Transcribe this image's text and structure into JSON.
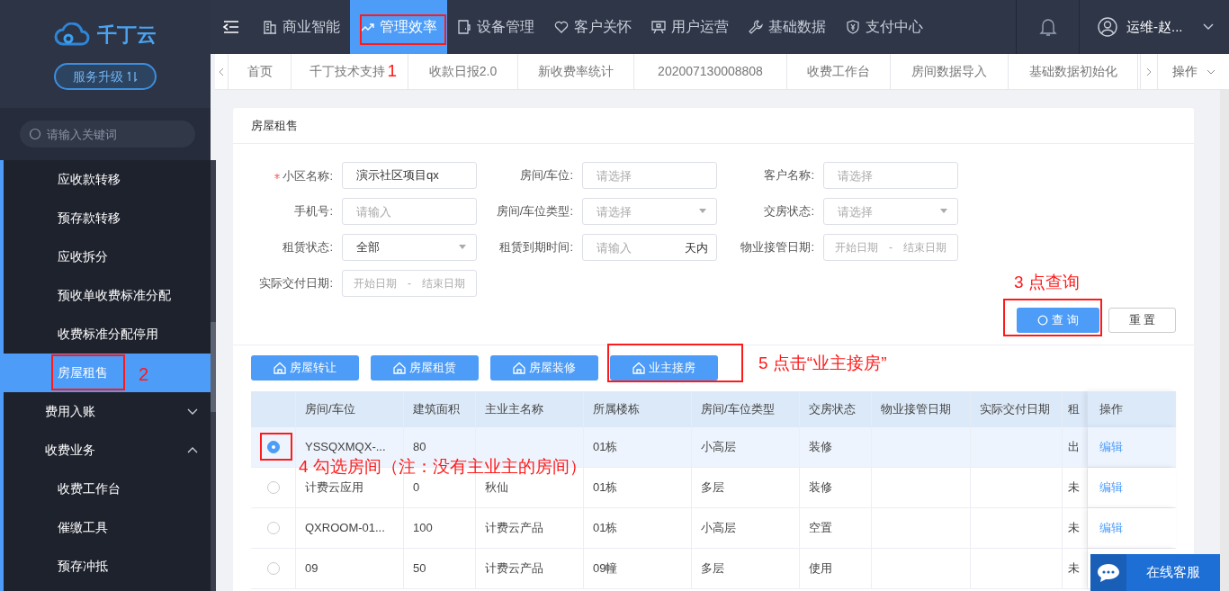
{
  "logo": {
    "text": "千丁云"
  },
  "upgrade_button": "服务升级",
  "top_nav": [
    {
      "label": "商业智能",
      "selected": false,
      "annotated": false
    },
    {
      "label": "管理效率",
      "selected": true,
      "annotated": true
    },
    {
      "label": "设备管理",
      "selected": false,
      "annotated": false
    },
    {
      "label": "客户关怀",
      "selected": false,
      "annotated": false
    },
    {
      "label": "用户运营",
      "selected": false,
      "annotated": false
    },
    {
      "label": "基础数据",
      "selected": false,
      "annotated": false
    },
    {
      "label": "支付中心",
      "selected": false,
      "annotated": false
    }
  ],
  "user": {
    "name": "运维-赵..."
  },
  "tabs": [
    {
      "label": "首页"
    },
    {
      "label": "千丁技术支持",
      "annotation": "1"
    },
    {
      "label": "收款日报2.0"
    },
    {
      "label": "新收费率统计"
    },
    {
      "label": "202007130008808"
    },
    {
      "label": "收费工作台"
    },
    {
      "label": "房间数据导入"
    },
    {
      "label": "基础数据初始化"
    }
  ],
  "tabs_menu": "操作",
  "sidebar": {
    "search_placeholder": "请输入关键词",
    "items": [
      {
        "children": [
          {
            "label": "应收款转移",
            "selected": false
          },
          {
            "label": "预存款转移",
            "selected": false
          },
          {
            "label": "应收拆分",
            "selected": false
          },
          {
            "label": "预收单收费标准分配",
            "selected": false
          },
          {
            "label": "收费标准分配停用",
            "selected": false
          },
          {
            "label": "房屋租售",
            "selected": true,
            "annotation": "2"
          }
        ]
      },
      {
        "label": "费用入账",
        "expanded": false
      },
      {
        "label": "收费业务",
        "expanded": true,
        "children": [
          {
            "label": "收费工作台",
            "selected": false
          },
          {
            "label": "催缴工具",
            "selected": false
          },
          {
            "label": "预存冲抵",
            "selected": false
          }
        ]
      }
    ]
  },
  "page_title": "房屋租售",
  "form": {
    "fields": [
      {
        "kind": "text",
        "label": "小区名称:",
        "required": true,
        "value": "演示社区项目qx"
      },
      {
        "kind": "text",
        "label": "房间/车位:",
        "required": false,
        "placeholder": "请选择"
      },
      {
        "kind": "text",
        "label": "客户名称:",
        "required": false,
        "placeholder": "请选择"
      },
      {
        "kind": "text",
        "label": "手机号:",
        "required": false,
        "placeholder": "请输入"
      },
      {
        "kind": "select",
        "label": "房间/车位类型:",
        "required": false,
        "placeholder": "请选择"
      },
      {
        "kind": "select",
        "label": "交房状态:",
        "required": false,
        "placeholder": "请选择"
      },
      {
        "kind": "select",
        "label": "租赁状态:",
        "required": false,
        "value": "全部"
      },
      {
        "kind": "days",
        "label": "租赁到期时间:",
        "required": false,
        "placeholder": "请输入",
        "suffix": "天内"
      },
      {
        "kind": "date_range",
        "label": "物业接管日期:",
        "required": false,
        "start_placeholder": "开始日期",
        "separator": "-",
        "end_placeholder": "结束日期"
      },
      {
        "kind": "date_range",
        "label": "实际交付日期:",
        "required": false,
        "start_placeholder": "开始日期",
        "separator": "-",
        "end_placeholder": "结束日期"
      }
    ],
    "query_button": {
      "label": "查 询",
      "annotated": true,
      "annotation": "3 点查询"
    },
    "reset_button": "重 置"
  },
  "actions": [
    {
      "label": "房屋转让",
      "annotated": false
    },
    {
      "label": "房屋租赁",
      "annotated": false
    },
    {
      "label": "房屋装修",
      "annotated": false
    },
    {
      "label": "业主接房",
      "annotated": true,
      "annotation": "5 点击“业主接房”"
    }
  ],
  "table": {
    "columns": [
      "房间/车位",
      "建筑面积",
      "主业主名称",
      "所属楼栋",
      "房间/车位类型",
      "交房状态",
      "物业接管日期",
      "实际交付日期",
      "租",
      "操作"
    ],
    "rows": [
      {
        "selected": true,
        "annotated": true,
        "annotation": "4 勾选房间（注：没有主业主的房间）",
        "cells": [
          "YSSQXMQX-...",
          "80",
          null,
          "01栋",
          "小高层",
          "装修",
          null,
          null,
          "出"
        ],
        "action": "编辑"
      },
      {
        "selected": false,
        "annotated": false,
        "cells": [
          "计费云应用",
          "0",
          "秋仙",
          "01栋",
          "多层",
          "装修",
          null,
          null,
          "未"
        ],
        "action": "编辑"
      },
      {
        "selected": false,
        "annotated": false,
        "cells": [
          "QXROOM-01...",
          "100",
          "计费云产品",
          "01栋",
          "小高层",
          "空置",
          null,
          null,
          "未"
        ],
        "action": "编辑"
      },
      {
        "selected": false,
        "annotated": false,
        "cells": [
          "09",
          "50",
          "计费云产品",
          "09幢",
          "多层",
          "使用",
          null,
          null,
          "未"
        ]
      }
    ]
  },
  "chat_button": "在线客服"
}
